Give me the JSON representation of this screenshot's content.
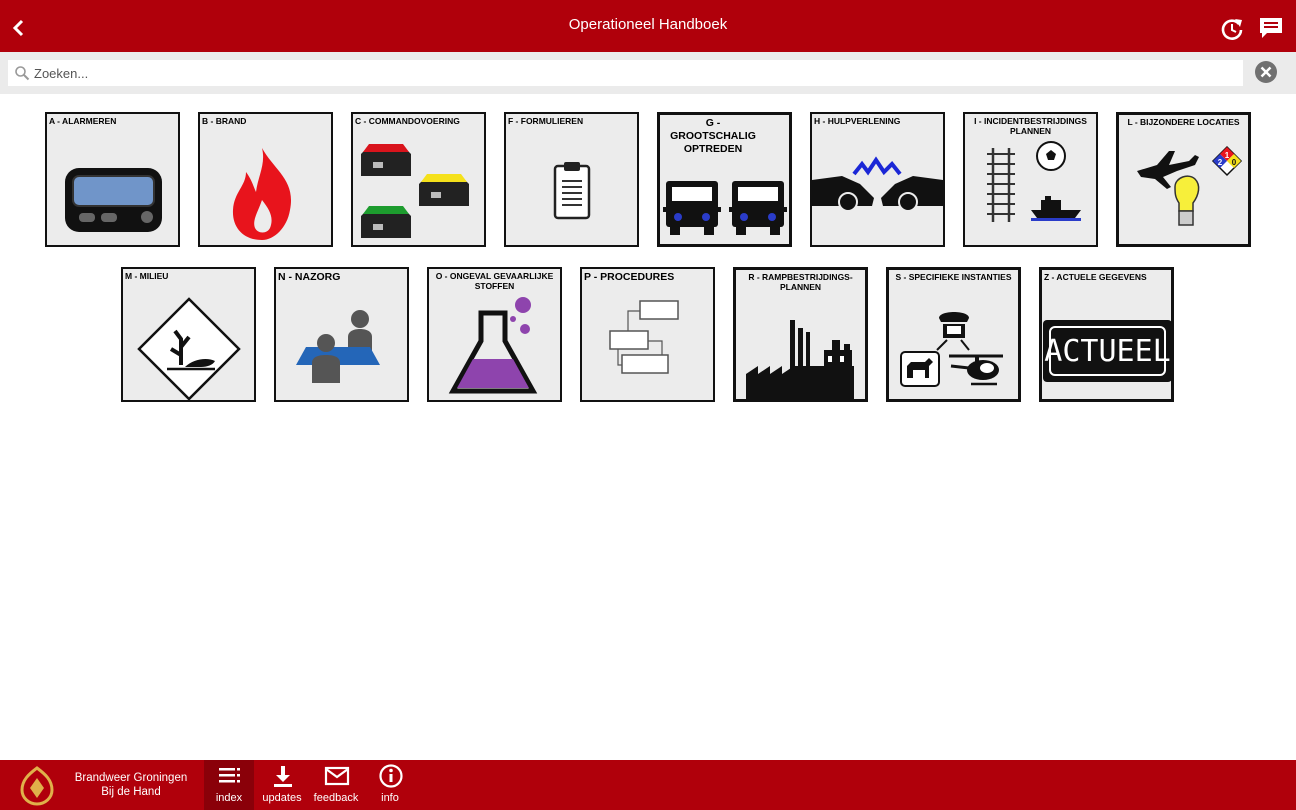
{
  "header": {
    "title": "Operationeel Handboek",
    "back_icon": "chevron-left-icon",
    "refresh_icon": "refresh-icon",
    "feedback_icon": "chat-icon"
  },
  "search": {
    "placeholder": "Zoeken...",
    "value": ""
  },
  "tiles": [
    {
      "label": "A - ALARMEREN"
    },
    {
      "label": "B - BRAND"
    },
    {
      "label": "C - COMMANDOVOERING"
    },
    {
      "label": "F - FORMULIEREN"
    },
    {
      "label": "G - GROOTSCHALIG OPTREDEN"
    },
    {
      "label": "H - HULPVERLENING"
    },
    {
      "label": "I - INCIDENTBESTRIJDINGS PLANNEN"
    },
    {
      "label": "L - BIJZONDERE LOCATIES"
    },
    {
      "label": "M - MILIEU"
    },
    {
      "label": "N - NAZORG"
    },
    {
      "label": "O - ONGEVAL GEVAARLIJKE STOFFEN"
    },
    {
      "label": "P - PROCEDURES"
    },
    {
      "label": "R - RAMPBESTRIJDINGS- PLANNEN"
    },
    {
      "label": "S - SPECIFIEKE INSTANTIES"
    },
    {
      "label": "Z - ACTUELE GEGEVENS",
      "badge": "ACTUEEL"
    }
  ],
  "hazard_diamond": {
    "top": "1",
    "left": "2",
    "right": "0"
  },
  "footer": {
    "brand_line1": "Brandweer Groningen",
    "brand_line2": "Bij de Hand",
    "nav": [
      {
        "label": "index",
        "icon": "list-icon",
        "active": true
      },
      {
        "label": "updates",
        "icon": "download-icon",
        "active": false
      },
      {
        "label": "feedback",
        "icon": "mail-icon",
        "active": false
      },
      {
        "label": "info",
        "icon": "info-icon",
        "active": false
      }
    ]
  },
  "colors": {
    "brand_red": "#b0000b",
    "active_red": "#8a0009",
    "search_bg": "#ebebeb",
    "tile_bg": "#ececec"
  }
}
